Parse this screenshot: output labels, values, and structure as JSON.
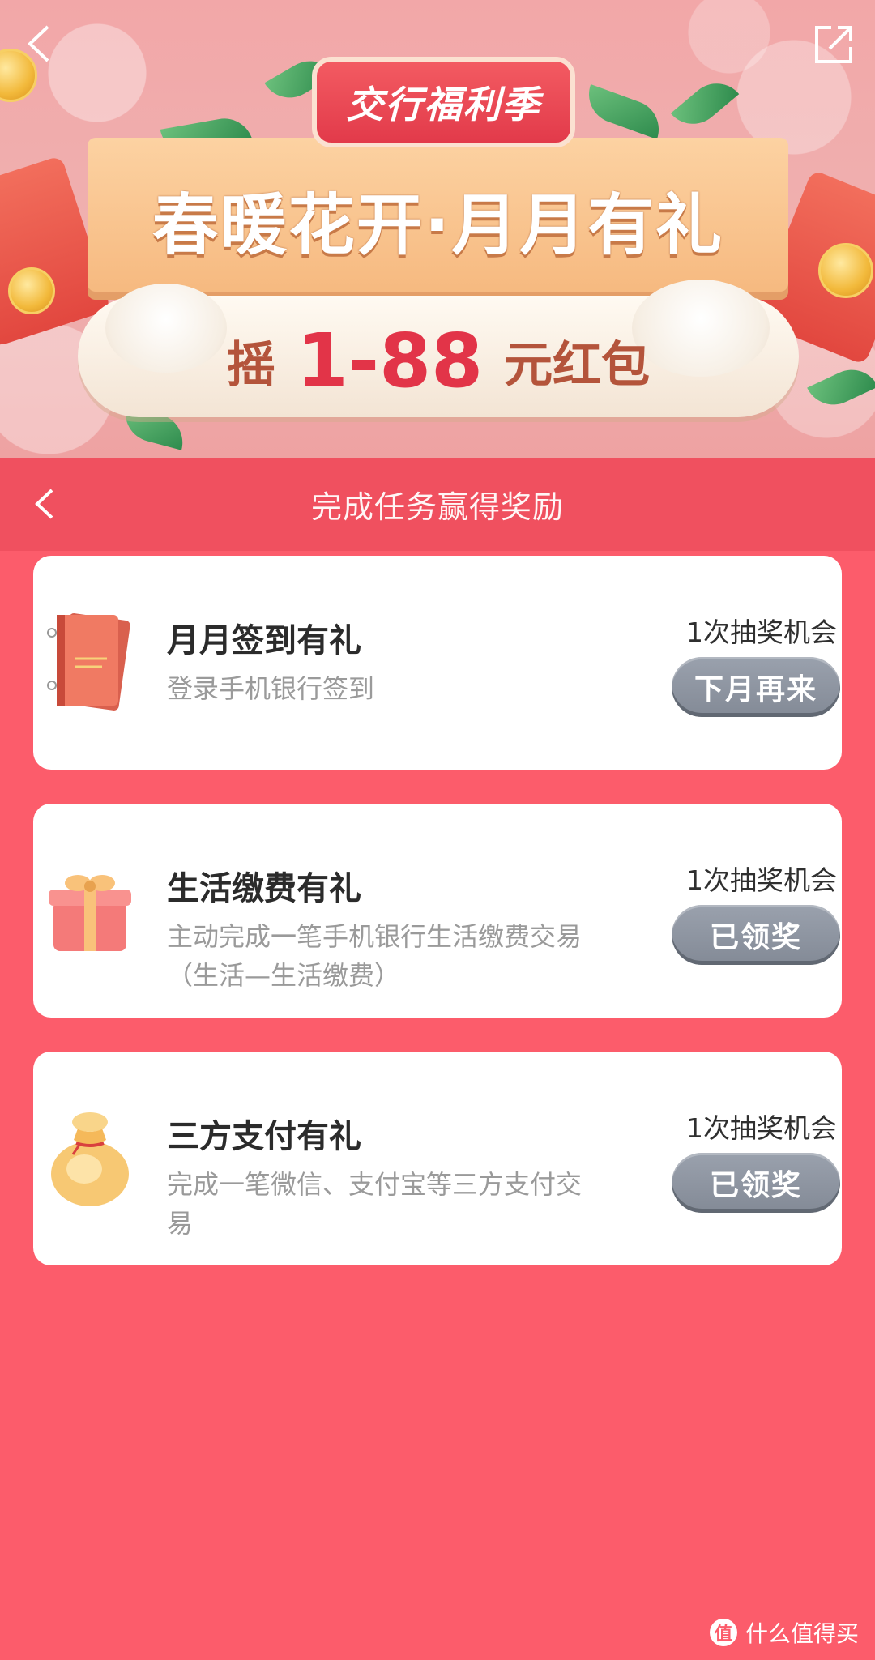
{
  "banner": {
    "badge": "交行福利季",
    "headline": "春暖花开·月月有礼",
    "prize_pre": "摇",
    "prize_range": "1-88",
    "prize_post": "元红包",
    "back_icon": "chevron-left-icon",
    "share_icon": "share-external-icon"
  },
  "title_bar": {
    "title": "完成任务赢得奖励",
    "back_icon": "chevron-left-icon"
  },
  "tasks": [
    {
      "title": "月月签到有礼",
      "desc": "登录手机银行签到",
      "chance": "1次抽奖机会",
      "button": "下月再来",
      "icon": "notebook-icon"
    },
    {
      "title": "生活缴费有礼",
      "desc": "主动完成一笔手机银行生活缴费交易（生活—生活缴费）",
      "chance": "1次抽奖机会",
      "button": "已领奖",
      "icon": "gift-box-icon"
    },
    {
      "title": "三方支付有礼",
      "desc": "完成一笔微信、支付宝等三方支付交易",
      "chance": "1次抽奖机会",
      "button": "已领奖",
      "icon": "money-bag-icon"
    }
  ],
  "watermark": {
    "logo": "值",
    "text": "什么值得买"
  },
  "colors": {
    "page_bg": "#fc5c6b",
    "title_bar": "#f0505f",
    "button_gray": "#8b919c",
    "accent_red": "#e23448"
  }
}
